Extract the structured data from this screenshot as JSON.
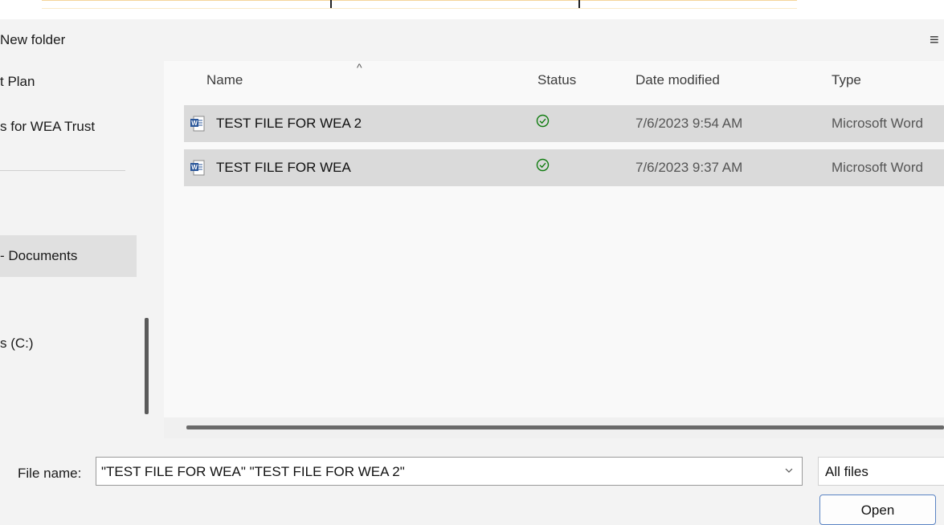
{
  "toolbar": {
    "new_folder": "New folder"
  },
  "nav": {
    "items": [
      {
        "label": "t Plan"
      },
      {
        "label": "s for WEA Trust"
      },
      {
        "label": "- Documents"
      },
      {
        "label": "s (C:)"
      }
    ]
  },
  "filelist": {
    "columns": {
      "name": "Name",
      "status": "Status",
      "date": "Date modified",
      "type": "Type"
    },
    "rows": [
      {
        "name": "TEST FILE FOR WEA 2",
        "date": "7/6/2023 9:54 AM",
        "type": "Microsoft Word",
        "status_icon": "synced-check-icon"
      },
      {
        "name": "TEST FILE FOR WEA",
        "date": "7/6/2023 9:37 AM",
        "type": "Microsoft Word",
        "status_icon": "synced-check-icon"
      }
    ]
  },
  "bottom": {
    "file_name_label": "File name:",
    "file_name_value": "\"TEST FILE FOR WEA\" \"TEST FILE FOR WEA 2\"",
    "filter_value": "All files",
    "open_label": "Open"
  },
  "colors": {
    "accent": "#5b84c4",
    "word_blue": "#2b579a",
    "status_green": "#107c10",
    "selection": "#dadada"
  }
}
